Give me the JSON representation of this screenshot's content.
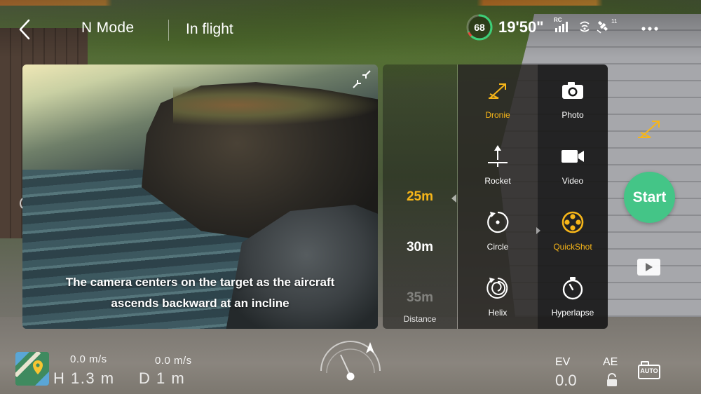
{
  "topbar": {
    "mode": "N Mode",
    "flight_status": "In flight",
    "battery_percent": "68",
    "battery_level": 0.68,
    "flight_time": "19'50\"",
    "rc_label": "RC",
    "gps_satellites": "11",
    "icons": {
      "back": "chevron-left-icon",
      "rc_signal": "rc-signal-icon",
      "video_signal": "video-signal-icon",
      "gps": "gps-satellite-icon",
      "more": "more-icon"
    }
  },
  "preview": {
    "caption_line1": "The camera centers on the target as the aircraft",
    "caption_line2": "ascends backward at an incline"
  },
  "distance": {
    "options": [
      "25m",
      "30m",
      "35m"
    ],
    "selected": "25m",
    "label": "Distance"
  },
  "quickshots": {
    "items": [
      {
        "label": "Dronie",
        "icon": "dronie-icon",
        "selected": true
      },
      {
        "label": "Rocket",
        "icon": "rocket-icon",
        "selected": false
      },
      {
        "label": "Circle",
        "icon": "circle-icon",
        "selected": false
      },
      {
        "label": "Helix",
        "icon": "helix-icon",
        "selected": false
      }
    ]
  },
  "camera_modes": {
    "items": [
      {
        "label": "Photo",
        "icon": "camera-icon",
        "selected": false
      },
      {
        "label": "Video",
        "icon": "video-camera-icon",
        "selected": false
      },
      {
        "label": "QuickShot",
        "icon": "quickshot-reel-icon",
        "selected": true
      },
      {
        "label": "Hyperlapse",
        "icon": "stopwatch-icon",
        "selected": false
      }
    ]
  },
  "controls": {
    "start_label": "Start"
  },
  "telemetry": {
    "vertical_speed": "0.0 m/s",
    "height": "H 1.3 m",
    "horizontal_speed": "0.0 m/s",
    "distance": "D 1 m"
  },
  "exposure": {
    "ev_label": "EV",
    "ev_value": "0.0",
    "ae_label": "AE",
    "auto_label": "AUTO"
  },
  "colors": {
    "accent": "#f7b619",
    "start_button": "#44c587",
    "battery_ring": "#3ccf78",
    "battery_ring_warn": "#e8453c"
  }
}
